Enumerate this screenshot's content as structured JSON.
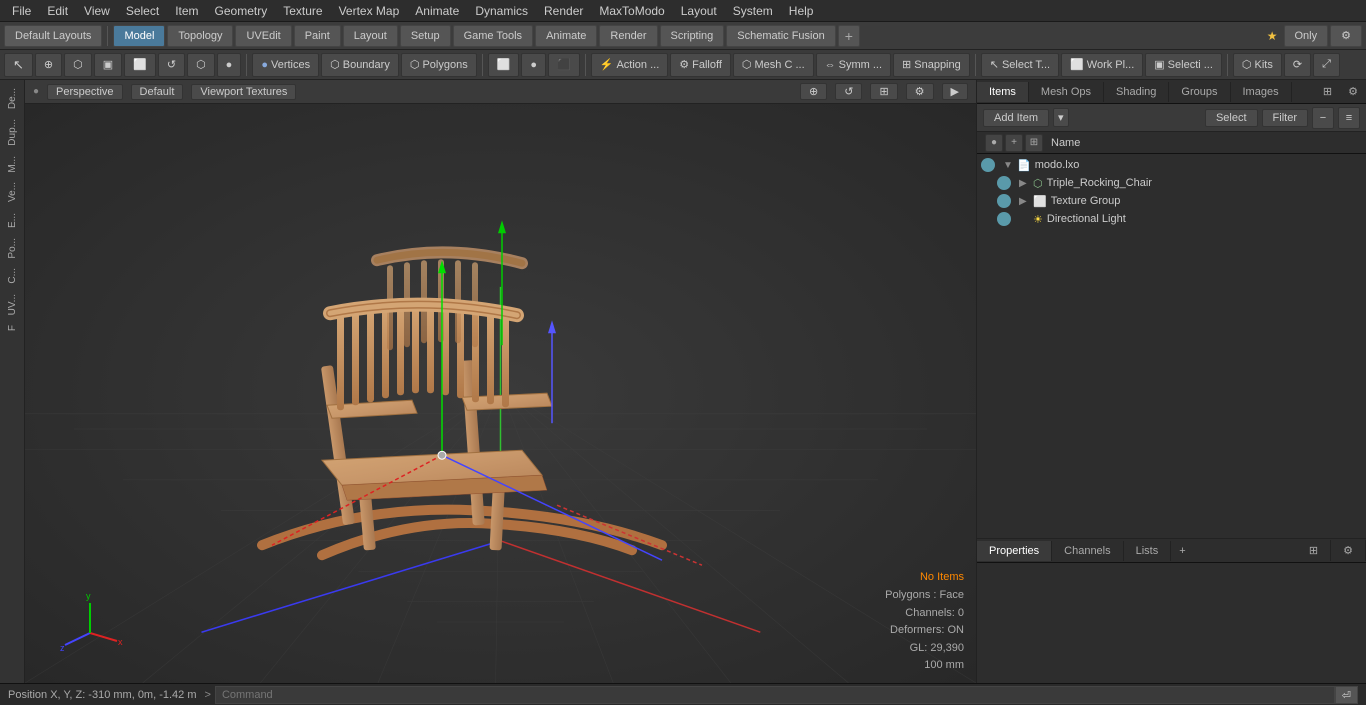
{
  "menubar": {
    "items": [
      "File",
      "Edit",
      "View",
      "Select",
      "Item",
      "Geometry",
      "Texture",
      "Vertex Map",
      "Animate",
      "Dynamics",
      "Render",
      "MaxToModo",
      "Layout",
      "System",
      "Help"
    ]
  },
  "toolbar1": {
    "layouts_label": "Default Layouts",
    "tabs": [
      "Model",
      "Topology",
      "UVEdit",
      "Paint",
      "Layout",
      "Setup",
      "Game Tools",
      "Animate",
      "Render",
      "Scripting",
      "Schematic Fusion"
    ],
    "plus_label": "+",
    "star_label": "★ Only",
    "settings_label": "⚙"
  },
  "toolbar2": {
    "buttons": [
      {
        "label": "⬛",
        "name": "select-mode"
      },
      {
        "label": "⊕",
        "name": "world-icon"
      },
      {
        "label": "⬡",
        "name": "polygon-icon"
      },
      {
        "label": "⬜",
        "name": "box-select"
      },
      {
        "label": "⬜",
        "name": "loop-select"
      },
      {
        "label": "↺",
        "name": "rotate-icon"
      },
      {
        "label": "⬡",
        "name": "mesh-icon"
      },
      {
        "label": "●",
        "name": "vertex-icon"
      },
      {
        "label": "Vertices",
        "name": "vertices-btn"
      },
      {
        "label": "Boundary",
        "name": "boundary-btn"
      },
      {
        "label": "Polygons",
        "name": "polygons-btn"
      },
      {
        "label": "⬜",
        "name": "edges-btn"
      },
      {
        "label": "●",
        "name": "dot-btn"
      },
      {
        "label": "⬛",
        "name": "tex-btn"
      },
      {
        "label": "Action ...",
        "name": "action-btn"
      },
      {
        "label": "Falloff",
        "name": "falloff-btn"
      },
      {
        "label": "Mesh C ...",
        "name": "mesh-c-btn"
      },
      {
        "label": "Symm ...",
        "name": "symm-btn"
      },
      {
        "label": "Snapping",
        "name": "snapping-btn"
      },
      {
        "label": "Select T...",
        "name": "select-t-btn"
      },
      {
        "label": "Work Pl...",
        "name": "work-plane-btn"
      },
      {
        "label": "Selecti ...",
        "name": "selecti-btn"
      },
      {
        "label": "Kits",
        "name": "kits-btn"
      },
      {
        "label": "⟳",
        "name": "refresh-btn"
      },
      {
        "label": "⤢",
        "name": "expand-btn"
      }
    ]
  },
  "viewport": {
    "camera_label": "Perspective",
    "render_label": "Default",
    "texture_label": "Viewport Textures",
    "icons": [
      "⊕",
      "↺",
      "⊞",
      "⚙",
      "▶"
    ]
  },
  "left_sidebar": {
    "items": [
      "De...",
      "Dup...",
      "M...",
      "Ve...",
      "E...",
      "Po...",
      "C...",
      "UV...",
      "F"
    ]
  },
  "scene": {
    "status": {
      "no_items": "No Items",
      "polygons": "Polygons : Face",
      "channels": "Channels: 0",
      "deformers": "Deformers: ON",
      "gl": "GL: 29,390",
      "size": "100 mm"
    },
    "position": "Position X, Y, Z:  -310 mm, 0m, -1.42 m"
  },
  "items_panel": {
    "tabs": [
      "Items",
      "Mesh Ops",
      "Shading",
      "Groups",
      "Images"
    ],
    "add_item_label": "Add Item",
    "select_label": "Select",
    "filter_label": "Filter",
    "name_col": "Name",
    "tree": [
      {
        "id": "root",
        "label": "modo.lxo",
        "icon": "file",
        "indent": 0,
        "expanded": true
      },
      {
        "id": "mesh",
        "label": "Triple_Rocking_Chair",
        "icon": "mesh",
        "indent": 1,
        "expanded": false
      },
      {
        "id": "texgrp",
        "label": "Texture Group",
        "icon": "texgroup",
        "indent": 1,
        "expanded": false
      },
      {
        "id": "light",
        "label": "Directional Light",
        "icon": "light",
        "indent": 1,
        "expanded": false
      }
    ]
  },
  "properties_panel": {
    "tabs": [
      "Properties",
      "Channels",
      "Lists"
    ],
    "plus_label": "+"
  },
  "statusbar": {
    "position_text": "Position X, Y, Z:  -310 mm, 0m, -1.42 m",
    "command_placeholder": "Command"
  }
}
